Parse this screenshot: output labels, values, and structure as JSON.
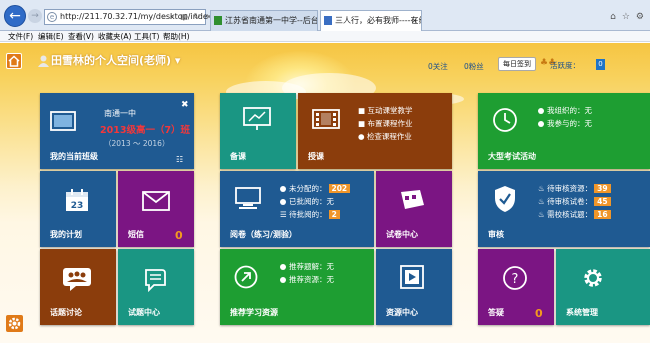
{
  "browser": {
    "url": "http://211.70.32.71/my/desktop/inde",
    "tabs": [
      {
        "label": "江苏省南通第一中学--后台管理"
      },
      {
        "label": "三人行，必有我师----在线..."
      }
    ]
  },
  "menu": [
    "文件(F)",
    "编辑(E)",
    "查看(V)",
    "收藏夹(A)",
    "工具(T)",
    "帮助(H)"
  ],
  "header": {
    "title": "田雪林的个人空间(老师)",
    "follow": "0关注",
    "fans": "0粉丝",
    "signin": "每日签到",
    "activity_label": "活跃度：",
    "activity_value": "0"
  },
  "tiles": {
    "class": {
      "school": "南通一中",
      "class_name": "2013级高一（7）班",
      "years": "（2013 ～ 2016）",
      "label": "我的当前班级"
    },
    "prepare": {
      "label": "备课"
    },
    "teach": {
      "items": [
        "互动课堂教学",
        "布置课程作业",
        "检查课程作业"
      ],
      "label": "授课"
    },
    "exam": {
      "organized": "我组织的：无",
      "joined": "我参与的：无",
      "label": "大型考试活动"
    },
    "plan": {
      "label": "我的计划"
    },
    "sms": {
      "label": "短信",
      "count": "0"
    },
    "grading": {
      "unassigned_label": "未分配的：",
      "unassigned": "202",
      "reviewed_label": "已批阅的：",
      "reviewed": "无",
      "pending_label": "待批阅的：",
      "pending": "2",
      "label": "阅卷（练习/测验）"
    },
    "papers": {
      "label": "试卷中心"
    },
    "audit": {
      "res_label": "待审核资源：",
      "res": "39",
      "paper_label": "待审核试卷：",
      "paper": "45",
      "q_label": "需校核试题：",
      "q": "16",
      "label": "审核"
    },
    "topic": {
      "label": "话题讨论"
    },
    "questions": {
      "label": "试题中心"
    },
    "recommend": {
      "answers": "推荐题解：无",
      "resources": "推荐资源：无",
      "label": "推荐学习资源"
    },
    "resources": {
      "label": "资源中心"
    },
    "qa": {
      "label": "答疑",
      "count": "0"
    },
    "system": {
      "label": "系统管理"
    }
  },
  "colors": {
    "blue": "#1f5a92",
    "teal": "#1a9683",
    "green": "#1e9e32",
    "brown": "#8b3d0c",
    "purple": "#7b1583",
    "orange": "#e07a18"
  }
}
